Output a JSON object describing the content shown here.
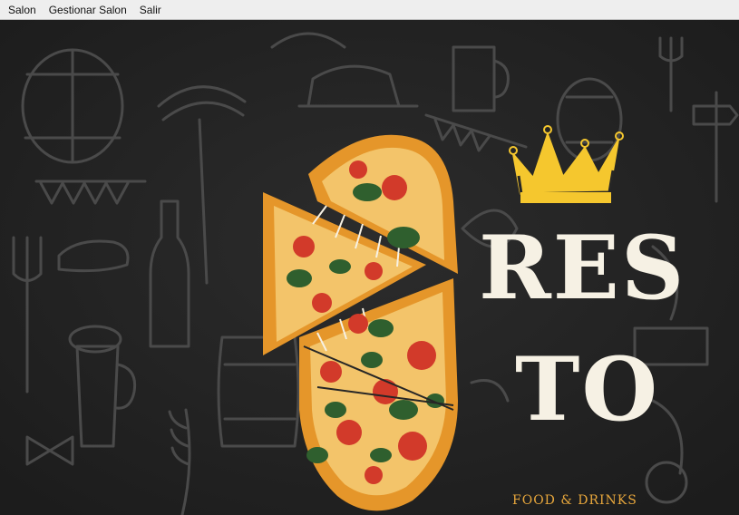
{
  "menubar": {
    "items": [
      {
        "label": "Salon"
      },
      {
        "label": "Gestionar Salon"
      },
      {
        "label": "Salir"
      }
    ]
  },
  "hero": {
    "title_line1": "RES",
    "title_line2": "TO",
    "tagline": "FOOD & DRINKS"
  },
  "colors": {
    "background": "#262626",
    "doodle": "#4a4a4a",
    "crown": "#f5c72e",
    "pizza_crust": "#e5962a",
    "pizza_cheese": "#f3c46a",
    "tomato": "#d23a2a",
    "basil": "#2f5f2e",
    "title": "#f6f1e4",
    "tagline": "#e8a73c"
  },
  "icons": [
    "crown-icon",
    "pizza-illustration",
    "chalkboard-doodles"
  ]
}
